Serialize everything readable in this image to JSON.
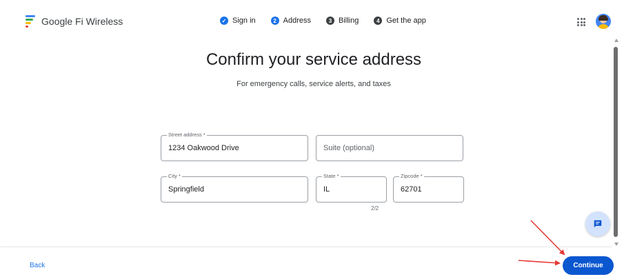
{
  "header": {
    "brand_name": "Google Fi Wireless",
    "steps": [
      {
        "num": "✓",
        "label": "Sign in",
        "state": "done"
      },
      {
        "num": "2",
        "label": "Address",
        "state": "current"
      },
      {
        "num": "3",
        "label": "Billing",
        "state": "upcoming"
      },
      {
        "num": "4",
        "label": "Get the app",
        "state": "upcoming"
      }
    ]
  },
  "main": {
    "title": "Confirm your service address",
    "subtitle": "For emergency calls, service alerts, and taxes",
    "fields": {
      "street": {
        "label": "Street address *",
        "value": "1234 Oakwood Drive"
      },
      "suite": {
        "placeholder": "Suite (optional)"
      },
      "city": {
        "label": "City *",
        "value": "Springfield"
      },
      "state": {
        "label": "State *",
        "value": "IL"
      },
      "zipcode": {
        "label": "Zipcode *",
        "value": "62701"
      }
    },
    "state_counter": "2/2"
  },
  "footer": {
    "back_label": "Back",
    "continue_label": "Continue"
  },
  "colors": {
    "accent": "#1a73e8",
    "primary_button": "#0b57d0",
    "annotation_arrow": "#e53935"
  }
}
